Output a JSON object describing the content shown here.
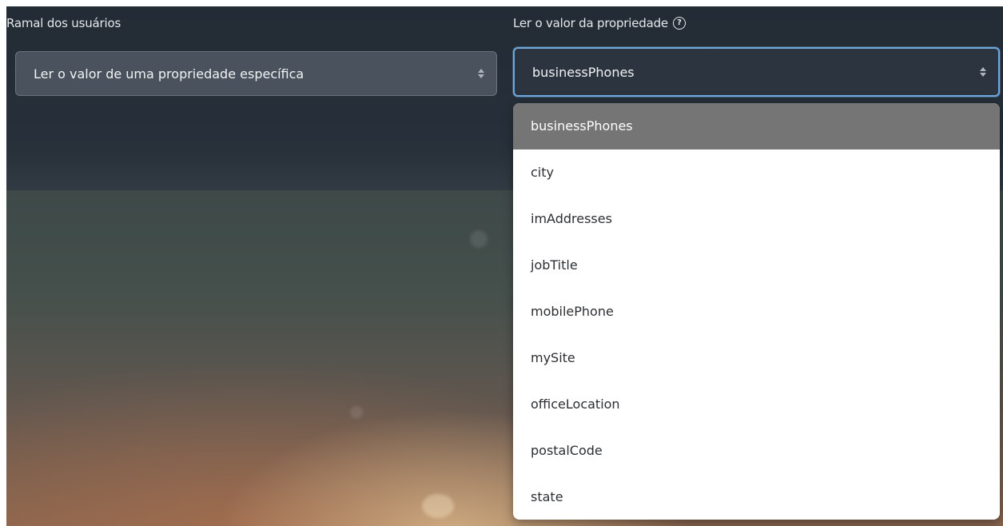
{
  "fields": {
    "left_label": "Ramal dos usuários",
    "right_label": "Ler o valor da propriedade"
  },
  "icons": {
    "help": "help-circle-icon",
    "sort": "sort-updown-icon"
  },
  "left_select": {
    "value": "Ler o valor de uma propriedade específica"
  },
  "right_select": {
    "value": "businessPhones",
    "selected_index": 0,
    "options": [
      "businessPhones",
      "city",
      "imAddresses",
      "jobTitle",
      "mobilePhone",
      "mySite",
      "officeLocation",
      "postalCode",
      "state"
    ]
  },
  "colors": {
    "focus_border": "#6fa8dc",
    "selected_option_bg": "#757575"
  }
}
